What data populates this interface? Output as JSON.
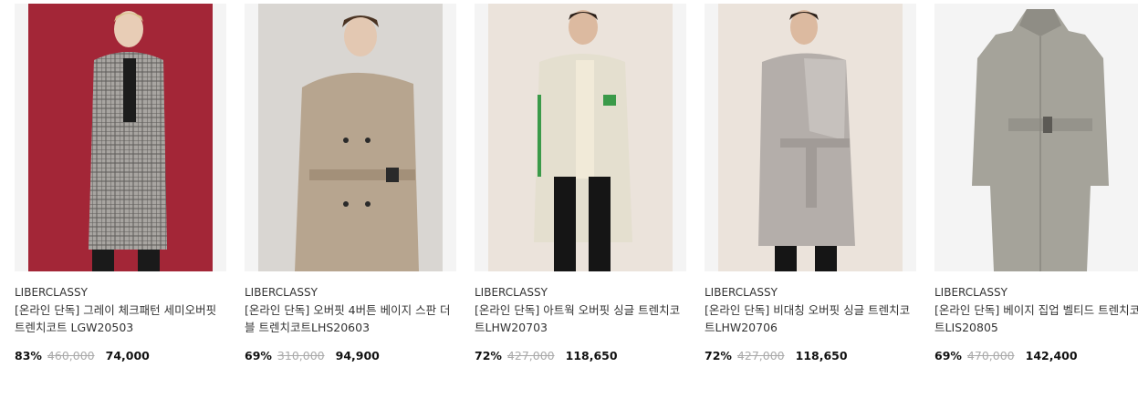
{
  "products": [
    {
      "brand": "LIBERCLASSY",
      "title": "[온라인 단독] 그레이 체크패턴 세미오버핏 트렌치코트 LGW20503",
      "discount": "83%",
      "original_price": "460,000",
      "price": "74,000",
      "image_icon": "model-grey-check-coat-image",
      "bg_color": "#a32637"
    },
    {
      "brand": "LIBERCLASSY",
      "title": "[온라인 단독] 오버핏 4버튼 베이지 스판 더블 트렌치코트LHS20603",
      "discount": "69%",
      "original_price": "310,000",
      "price": "94,900",
      "image_icon": "model-beige-double-trench-image",
      "bg_color": "#d9d6d2"
    },
    {
      "brand": "LIBERCLASSY",
      "title": "[온라인 단독] 아트웍 오버핏 싱글 트렌치코트LHW20703",
      "discount": "72%",
      "original_price": "427,000",
      "price": "118,650",
      "image_icon": "model-cream-single-trench-image",
      "bg_color": "#ebe3db"
    },
    {
      "brand": "LIBERCLASSY",
      "title": "[온라인 단독] 비대칭 오버핏 싱글 트렌치코트LHW20706",
      "discount": "72%",
      "original_price": "427,000",
      "price": "118,650",
      "image_icon": "model-grey-asymmetric-trench-image",
      "bg_color": "#ebe3db"
    },
    {
      "brand": "LIBERCLASSY",
      "title": "[온라인 단독] 베이지 집업 벨티드 트렌치코트LIS20805",
      "discount": "69%",
      "original_price": "470,000",
      "price": "142,400",
      "image_icon": "product-flat-grey-coat-image",
      "bg_color": "#f4f4f4"
    }
  ]
}
